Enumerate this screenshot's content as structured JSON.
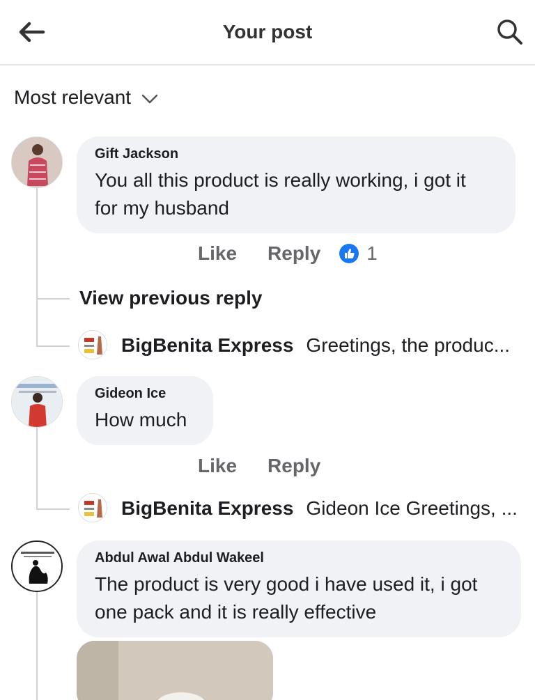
{
  "header": {
    "title": "Your post",
    "back_icon": "arrow-left-icon",
    "search_icon": "search-icon"
  },
  "sort": {
    "label": "Most relevant",
    "icon": "chevron-down-icon"
  },
  "comments": [
    {
      "author": "Gift Jackson",
      "text_lines": [
        "You all this product is really working, i got it",
        "for my husband"
      ],
      "like_label": "Like",
      "reply_label": "Reply",
      "reactions": "1",
      "view_previous": "View previous reply",
      "reply": {
        "author": "BigBenita Express",
        "text": "Greetings, the produc..."
      }
    },
    {
      "author": "Gideon Ice",
      "text_lines": [
        "How much"
      ],
      "like_label": "Like",
      "reply_label": "Reply",
      "reply": {
        "author": "BigBenita Express",
        "text": "Gideon Ice Greetings, ..."
      }
    },
    {
      "author": "Abdul Awal Abdul Wakeel",
      "text_lines": [
        "The product is very good i have used it, i got",
        "one pack and it is really effective"
      ]
    }
  ],
  "colors": {
    "like_blue": "#1877f2",
    "bubble_bg": "#f0f2f5",
    "secondary_text": "#65676b"
  }
}
